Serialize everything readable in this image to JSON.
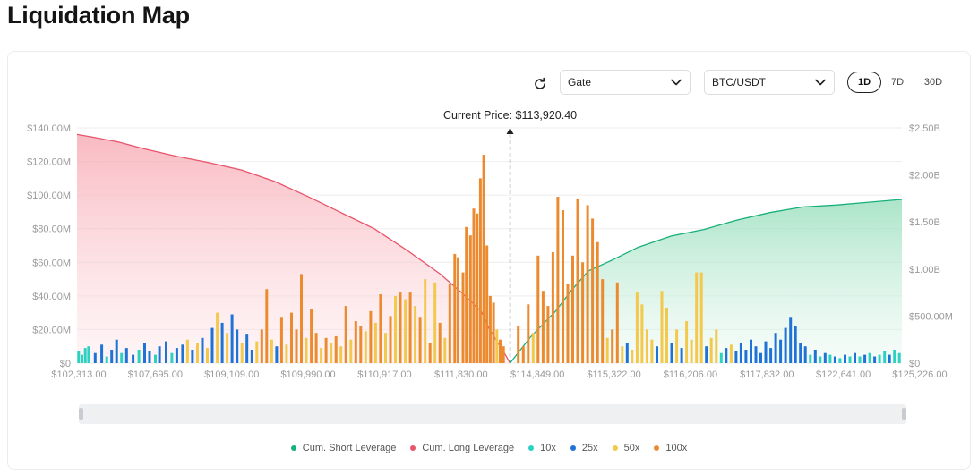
{
  "page": {
    "title": "Liquidation Map"
  },
  "controls": {
    "exchange": "Gate",
    "pair": "BTC/USDT",
    "timeframes": [
      "1D",
      "7D",
      "30D"
    ],
    "active_timeframe": "1D"
  },
  "icons": {
    "refresh": "refresh-icon",
    "dropdown": "chevron-down-icon"
  },
  "colors": {
    "short": "#18b07a",
    "long": "#e8546b",
    "x10": "#2dd1c2",
    "x25": "#1f73d6",
    "x50": "#f2c94c",
    "x100": "#ec8a30"
  },
  "chart_data": {
    "type": "bar",
    "title": "",
    "current_price_label": "Current Price: $113,920.40",
    "current_price_position": 0.525,
    "left_axis": {
      "ticks": [
        "$0",
        "$20.00M",
        "$40.00M",
        "$60.00M",
        "$80.00M",
        "$100.00M",
        "$120.00M",
        "$140.00M"
      ],
      "ylim": [
        0,
        140
      ],
      "unit": "M"
    },
    "right_axis": {
      "ticks": [
        "$0",
        "$500.00M",
        "$1.00B",
        "$1.50B",
        "$2.00B",
        "$2.50B"
      ],
      "ylim": [
        0,
        2.5
      ],
      "unit": "B"
    },
    "x_tick_labels": [
      "$102,313.00",
      "$107,695.00",
      "$109,109.00",
      "$109,990.00",
      "$110,917.00",
      "$111,830.00",
      "$114,349.00",
      "$115,322.00",
      "$116,206.00",
      "$117,832.00",
      "$122,641.00",
      "$125,226.00"
    ],
    "legend": [
      {
        "key": "short",
        "label": "Cum. Short Leverage"
      },
      {
        "key": "long",
        "label": "Cum. Long Leverage"
      },
      {
        "key": "x10",
        "label": "10x"
      },
      {
        "key": "x25",
        "label": "25x"
      },
      {
        "key": "x50",
        "label": "50x"
      },
      {
        "key": "x100",
        "label": "100x"
      }
    ],
    "cum_long_leverage": {
      "x": [
        0.0,
        0.02,
        0.05,
        0.08,
        0.12,
        0.16,
        0.2,
        0.24,
        0.28,
        0.32,
        0.36,
        0.4,
        0.44,
        0.47,
        0.49,
        0.5,
        0.51,
        0.52,
        0.525
      ],
      "values_b": [
        2.43,
        2.4,
        2.35,
        2.28,
        2.2,
        2.13,
        2.05,
        1.93,
        1.77,
        1.6,
        1.43,
        1.2,
        0.95,
        0.72,
        0.55,
        0.36,
        0.22,
        0.08,
        0.0
      ]
    },
    "cum_short_leverage": {
      "x": [
        0.525,
        0.55,
        0.58,
        0.6,
        0.62,
        0.65,
        0.68,
        0.72,
        0.76,
        0.8,
        0.84,
        0.88,
        0.92,
        0.96,
        1.0
      ],
      "values_b": [
        0.0,
        0.28,
        0.55,
        0.78,
        0.98,
        1.1,
        1.23,
        1.35,
        1.42,
        1.52,
        1.6,
        1.66,
        1.68,
        1.71,
        1.74
      ]
    },
    "bars": [
      {
        "x": 0.002,
        "lev": "x10",
        "value_m": 7
      },
      {
        "x": 0.006,
        "lev": "x10",
        "value_m": 5
      },
      {
        "x": 0.01,
        "lev": "x10",
        "value_m": 9
      },
      {
        "x": 0.014,
        "lev": "x10",
        "value_m": 10
      },
      {
        "x": 0.022,
        "lev": "x25",
        "value_m": 6
      },
      {
        "x": 0.03,
        "lev": "x25",
        "value_m": 11
      },
      {
        "x": 0.036,
        "lev": "x10",
        "value_m": 4
      },
      {
        "x": 0.042,
        "lev": "x25",
        "value_m": 8
      },
      {
        "x": 0.048,
        "lev": "x25",
        "value_m": 14
      },
      {
        "x": 0.054,
        "lev": "x10",
        "value_m": 6
      },
      {
        "x": 0.06,
        "lev": "x25",
        "value_m": 9
      },
      {
        "x": 0.068,
        "lev": "x25",
        "value_m": 5
      },
      {
        "x": 0.075,
        "lev": "x10",
        "value_m": 8
      },
      {
        "x": 0.082,
        "lev": "x25",
        "value_m": 12
      },
      {
        "x": 0.088,
        "lev": "x25",
        "value_m": 7
      },
      {
        "x": 0.095,
        "lev": "x10",
        "value_m": 5
      },
      {
        "x": 0.1,
        "lev": "x25",
        "value_m": 10
      },
      {
        "x": 0.108,
        "lev": "x25",
        "value_m": 13
      },
      {
        "x": 0.115,
        "lev": "x10",
        "value_m": 6
      },
      {
        "x": 0.121,
        "lev": "x25",
        "value_m": 9
      },
      {
        "x": 0.128,
        "lev": "x25",
        "value_m": 11
      },
      {
        "x": 0.134,
        "lev": "x50",
        "value_m": 14
      },
      {
        "x": 0.14,
        "lev": "x25",
        "value_m": 8
      },
      {
        "x": 0.146,
        "lev": "x50",
        "value_m": 12
      },
      {
        "x": 0.152,
        "lev": "x25",
        "value_m": 15
      },
      {
        "x": 0.158,
        "lev": "x50",
        "value_m": 9
      },
      {
        "x": 0.164,
        "lev": "x25",
        "value_m": 21
      },
      {
        "x": 0.17,
        "lev": "x50",
        "value_m": 30
      },
      {
        "x": 0.176,
        "lev": "x25",
        "value_m": 24
      },
      {
        "x": 0.182,
        "lev": "x50",
        "value_m": 18
      },
      {
        "x": 0.188,
        "lev": "x25",
        "value_m": 29
      },
      {
        "x": 0.194,
        "lev": "x25",
        "value_m": 20
      },
      {
        "x": 0.2,
        "lev": "x50",
        "value_m": 12
      },
      {
        "x": 0.206,
        "lev": "x25",
        "value_m": 17
      },
      {
        "x": 0.212,
        "lev": "x25",
        "value_m": 8
      },
      {
        "x": 0.218,
        "lev": "x50",
        "value_m": 13
      },
      {
        "x": 0.224,
        "lev": "x100",
        "value_m": 20
      },
      {
        "x": 0.23,
        "lev": "x100",
        "value_m": 44
      },
      {
        "x": 0.236,
        "lev": "x50",
        "value_m": 14
      },
      {
        "x": 0.242,
        "lev": "x25",
        "value_m": 10
      },
      {
        "x": 0.248,
        "lev": "x100",
        "value_m": 27
      },
      {
        "x": 0.254,
        "lev": "x50",
        "value_m": 11
      },
      {
        "x": 0.26,
        "lev": "x100",
        "value_m": 30
      },
      {
        "x": 0.266,
        "lev": "x100",
        "value_m": 20
      },
      {
        "x": 0.272,
        "lev": "x100",
        "value_m": 53
      },
      {
        "x": 0.278,
        "lev": "x50",
        "value_m": 15
      },
      {
        "x": 0.284,
        "lev": "x100",
        "value_m": 32
      },
      {
        "x": 0.29,
        "lev": "x100",
        "value_m": 18
      },
      {
        "x": 0.296,
        "lev": "x50",
        "value_m": 9
      },
      {
        "x": 0.302,
        "lev": "x100",
        "value_m": 15
      },
      {
        "x": 0.308,
        "lev": "x50",
        "value_m": 12
      },
      {
        "x": 0.314,
        "lev": "x100",
        "value_m": 16
      },
      {
        "x": 0.32,
        "lev": "x50",
        "value_m": 10
      },
      {
        "x": 0.326,
        "lev": "x100",
        "value_m": 34
      },
      {
        "x": 0.332,
        "lev": "x50",
        "value_m": 14
      },
      {
        "x": 0.338,
        "lev": "x100",
        "value_m": 25
      },
      {
        "x": 0.344,
        "lev": "x100",
        "value_m": 22
      },
      {
        "x": 0.35,
        "lev": "x50",
        "value_m": 19
      },
      {
        "x": 0.356,
        "lev": "x100",
        "value_m": 31
      },
      {
        "x": 0.362,
        "lev": "x50",
        "value_m": 24
      },
      {
        "x": 0.368,
        "lev": "x100",
        "value_m": 41
      },
      {
        "x": 0.374,
        "lev": "x50",
        "value_m": 18
      },
      {
        "x": 0.38,
        "lev": "x100",
        "value_m": 28
      },
      {
        "x": 0.386,
        "lev": "x50",
        "value_m": 40
      },
      {
        "x": 0.392,
        "lev": "x100",
        "value_m": 42
      },
      {
        "x": 0.398,
        "lev": "x50",
        "value_m": 38
      },
      {
        "x": 0.404,
        "lev": "x100",
        "value_m": 42
      },
      {
        "x": 0.41,
        "lev": "x50",
        "value_m": 34
      },
      {
        "x": 0.416,
        "lev": "x100",
        "value_m": 27
      },
      {
        "x": 0.422,
        "lev": "x50",
        "value_m": 50
      },
      {
        "x": 0.428,
        "lev": "x100",
        "value_m": 12
      },
      {
        "x": 0.434,
        "lev": "x50",
        "value_m": 48
      },
      {
        "x": 0.44,
        "lev": "x100",
        "value_m": 24
      },
      {
        "x": 0.446,
        "lev": "x50",
        "value_m": 15
      },
      {
        "x": 0.452,
        "lev": "x100",
        "value_m": 47
      },
      {
        "x": 0.458,
        "lev": "x100",
        "value_m": 65
      },
      {
        "x": 0.462,
        "lev": "x100",
        "value_m": 63
      },
      {
        "x": 0.468,
        "lev": "x100",
        "value_m": 54
      },
      {
        "x": 0.472,
        "lev": "x100",
        "value_m": 81
      },
      {
        "x": 0.477,
        "lev": "x100",
        "value_m": 76
      },
      {
        "x": 0.481,
        "lev": "x100",
        "value_m": 92
      },
      {
        "x": 0.485,
        "lev": "x100",
        "value_m": 89
      },
      {
        "x": 0.489,
        "lev": "x100",
        "value_m": 110
      },
      {
        "x": 0.493,
        "lev": "x100",
        "value_m": 124
      },
      {
        "x": 0.497,
        "lev": "x100",
        "value_m": 70
      },
      {
        "x": 0.501,
        "lev": "x100",
        "value_m": 40
      },
      {
        "x": 0.505,
        "lev": "x100",
        "value_m": 36
      },
      {
        "x": 0.509,
        "lev": "x50",
        "value_m": 20
      },
      {
        "x": 0.513,
        "lev": "x100",
        "value_m": 14
      },
      {
        "x": 0.517,
        "lev": "x100",
        "value_m": 10
      },
      {
        "x": 0.535,
        "lev": "x100",
        "value_m": 22
      },
      {
        "x": 0.541,
        "lev": "x100",
        "value_m": 10
      },
      {
        "x": 0.547,
        "lev": "x100",
        "value_m": 35
      },
      {
        "x": 0.553,
        "lev": "x50",
        "value_m": 18
      },
      {
        "x": 0.559,
        "lev": "x100",
        "value_m": 64
      },
      {
        "x": 0.565,
        "lev": "x100",
        "value_m": 43
      },
      {
        "x": 0.571,
        "lev": "x100",
        "value_m": 34
      },
      {
        "x": 0.577,
        "lev": "x100",
        "value_m": 66
      },
      {
        "x": 0.583,
        "lev": "x100",
        "value_m": 99
      },
      {
        "x": 0.589,
        "lev": "x100",
        "value_m": 91
      },
      {
        "x": 0.595,
        "lev": "x100",
        "value_m": 47
      },
      {
        "x": 0.601,
        "lev": "x100",
        "value_m": 64
      },
      {
        "x": 0.607,
        "lev": "x100",
        "value_m": 98
      },
      {
        "x": 0.613,
        "lev": "x100",
        "value_m": 60
      },
      {
        "x": 0.619,
        "lev": "x100",
        "value_m": 94
      },
      {
        "x": 0.625,
        "lev": "x100",
        "value_m": 86
      },
      {
        "x": 0.631,
        "lev": "x100",
        "value_m": 72
      },
      {
        "x": 0.637,
        "lev": "x100",
        "value_m": 50
      },
      {
        "x": 0.643,
        "lev": "x50",
        "value_m": 15
      },
      {
        "x": 0.649,
        "lev": "x100",
        "value_m": 20
      },
      {
        "x": 0.655,
        "lev": "x100",
        "value_m": 48
      },
      {
        "x": 0.661,
        "lev": "x50",
        "value_m": 10
      },
      {
        "x": 0.667,
        "lev": "x25",
        "value_m": 12
      },
      {
        "x": 0.673,
        "lev": "x50",
        "value_m": 8
      },
      {
        "x": 0.679,
        "lev": "x50",
        "value_m": 42
      },
      {
        "x": 0.685,
        "lev": "x50",
        "value_m": 35
      },
      {
        "x": 0.691,
        "lev": "x50",
        "value_m": 20
      },
      {
        "x": 0.697,
        "lev": "x50",
        "value_m": 14
      },
      {
        "x": 0.703,
        "lev": "x25",
        "value_m": 10
      },
      {
        "x": 0.709,
        "lev": "x50",
        "value_m": 43
      },
      {
        "x": 0.715,
        "lev": "x50",
        "value_m": 33
      },
      {
        "x": 0.721,
        "lev": "x25",
        "value_m": 12
      },
      {
        "x": 0.727,
        "lev": "x50",
        "value_m": 20
      },
      {
        "x": 0.733,
        "lev": "x25",
        "value_m": 9
      },
      {
        "x": 0.739,
        "lev": "x50",
        "value_m": 25
      },
      {
        "x": 0.745,
        "lev": "x50",
        "value_m": 14
      },
      {
        "x": 0.751,
        "lev": "x50",
        "value_m": 54
      },
      {
        "x": 0.757,
        "lev": "x50",
        "value_m": 54
      },
      {
        "x": 0.763,
        "lev": "x25",
        "value_m": 10
      },
      {
        "x": 0.769,
        "lev": "x50",
        "value_m": 15
      },
      {
        "x": 0.775,
        "lev": "x50",
        "value_m": 20
      },
      {
        "x": 0.781,
        "lev": "x10",
        "value_m": 6
      },
      {
        "x": 0.787,
        "lev": "x25",
        "value_m": 9
      },
      {
        "x": 0.793,
        "lev": "x50",
        "value_m": 11
      },
      {
        "x": 0.799,
        "lev": "x25",
        "value_m": 7
      },
      {
        "x": 0.805,
        "lev": "x25",
        "value_m": 12
      },
      {
        "x": 0.811,
        "lev": "x25",
        "value_m": 8
      },
      {
        "x": 0.817,
        "lev": "x25",
        "value_m": 14
      },
      {
        "x": 0.823,
        "lev": "x25",
        "value_m": 10
      },
      {
        "x": 0.829,
        "lev": "x25",
        "value_m": 6
      },
      {
        "x": 0.835,
        "lev": "x25",
        "value_m": 13
      },
      {
        "x": 0.841,
        "lev": "x25",
        "value_m": 9
      },
      {
        "x": 0.847,
        "lev": "x25",
        "value_m": 18
      },
      {
        "x": 0.853,
        "lev": "x25",
        "value_m": 14
      },
      {
        "x": 0.859,
        "lev": "x25",
        "value_m": 21
      },
      {
        "x": 0.865,
        "lev": "x25",
        "value_m": 27
      },
      {
        "x": 0.871,
        "lev": "x25",
        "value_m": 22
      },
      {
        "x": 0.877,
        "lev": "x25",
        "value_m": 12
      },
      {
        "x": 0.883,
        "lev": "x25",
        "value_m": 10
      },
      {
        "x": 0.889,
        "lev": "x10",
        "value_m": 5
      },
      {
        "x": 0.895,
        "lev": "x25",
        "value_m": 8
      },
      {
        "x": 0.901,
        "lev": "x10",
        "value_m": 4
      },
      {
        "x": 0.907,
        "lev": "x25",
        "value_m": 6
      },
      {
        "x": 0.913,
        "lev": "x10",
        "value_m": 5
      },
      {
        "x": 0.919,
        "lev": "x25",
        "value_m": 4
      },
      {
        "x": 0.925,
        "lev": "x10",
        "value_m": 3
      },
      {
        "x": 0.931,
        "lev": "x25",
        "value_m": 5
      },
      {
        "x": 0.937,
        "lev": "x10",
        "value_m": 4
      },
      {
        "x": 0.943,
        "lev": "x25",
        "value_m": 6
      },
      {
        "x": 0.949,
        "lev": "x10",
        "value_m": 4
      },
      {
        "x": 0.955,
        "lev": "x25",
        "value_m": 5
      },
      {
        "x": 0.961,
        "lev": "x10",
        "value_m": 6
      },
      {
        "x": 0.967,
        "lev": "x25",
        "value_m": 4
      },
      {
        "x": 0.973,
        "lev": "x10",
        "value_m": 5
      },
      {
        "x": 0.979,
        "lev": "x10",
        "value_m": 7
      },
      {
        "x": 0.985,
        "lev": "x25",
        "value_m": 5
      },
      {
        "x": 0.991,
        "lev": "x10",
        "value_m": 8
      },
      {
        "x": 0.997,
        "lev": "x10",
        "value_m": 6
      }
    ]
  }
}
